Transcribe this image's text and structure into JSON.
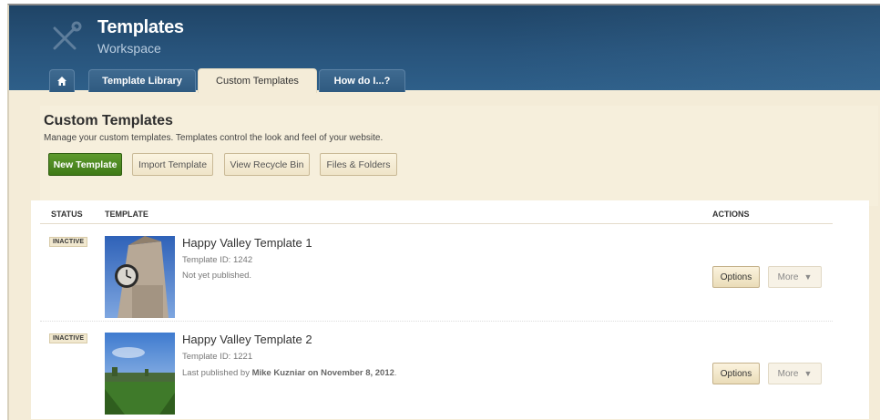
{
  "app": {
    "title": "Templates",
    "subtitle": "Workspace"
  },
  "tabs": [
    {
      "label": "Template Library"
    },
    {
      "label": "Custom Templates",
      "active": true
    },
    {
      "label": "How do I...?"
    }
  ],
  "intro": {
    "title": "Custom Templates",
    "description": "Manage your custom templates. Templates control the look and feel of your website.",
    "buttons": {
      "new": "New Template",
      "import": "Import Template",
      "recycle": "View Recycle Bin",
      "files": "Files & Folders"
    }
  },
  "table": {
    "headers": {
      "status": "STATUS",
      "template": "TEMPLATE",
      "actions": "ACTIONS"
    },
    "rows": [
      {
        "status": "INACTIVE",
        "name": "Happy Valley Template 1",
        "template_id": "Template ID: 1242",
        "status_text": "Not yet published.",
        "options": "Options",
        "more": "More"
      },
      {
        "status": "INACTIVE",
        "name": "Happy Valley Template 2",
        "template_id": "Template ID: 1221",
        "status_prefix": "Last published by ",
        "status_user": "Mike Kuzniar",
        "status_mid": " on ",
        "status_date": "November 8, 2012",
        "status_end": ".",
        "options": "Options",
        "more": "More"
      }
    ]
  },
  "colors": {
    "header": "#28547c",
    "primary_button": "#4a8620",
    "panel": "#f4ecd8"
  },
  "icons": [
    "tools-icon",
    "home-icon",
    "caret-down-icon"
  ]
}
